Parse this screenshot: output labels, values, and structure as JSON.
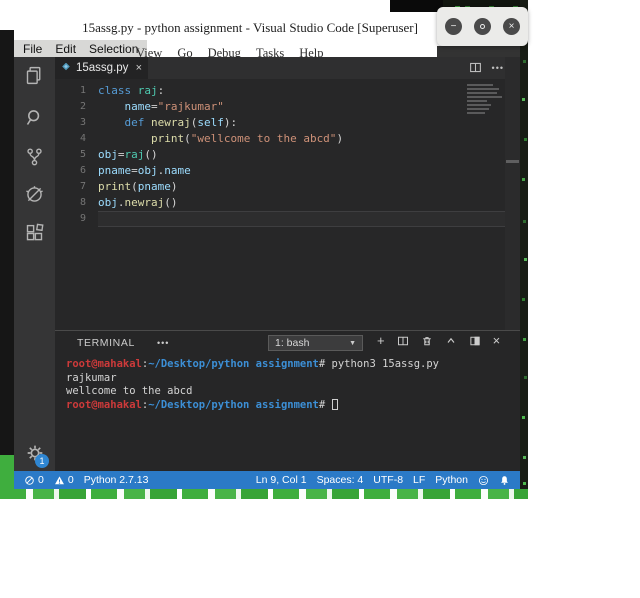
{
  "window": {
    "title": "15assg.py - python assignment - Visual Studio Code [Superuser]",
    "controls": {
      "minimize_glyph": "−",
      "close_glyph": "×"
    }
  },
  "menu_bar": {
    "left": [
      "File",
      "Edit",
      "Selection"
    ],
    "right": [
      "View",
      "Go",
      "Debug",
      "Tasks",
      "Help"
    ]
  },
  "activity_bar": {
    "icons": [
      "explorer",
      "search",
      "source-control",
      "debug",
      "extensions",
      "settings-gear"
    ],
    "settings_badge": "1"
  },
  "editor": {
    "tab": {
      "label": "15assg.py",
      "close_glyph": "×",
      "icon": "python-file-icon"
    },
    "actions": {
      "more_glyph": "•••"
    },
    "lines": [
      {
        "n": "1",
        "tokens": [
          {
            "c": "kw",
            "t": "class"
          },
          {
            "c": "pl",
            "t": " "
          },
          {
            "c": "cls",
            "t": "raj"
          },
          {
            "c": "pl",
            "t": ":"
          }
        ]
      },
      {
        "n": "2",
        "tokens": [
          {
            "c": "pl",
            "t": "    "
          },
          {
            "c": "var",
            "t": "name"
          },
          {
            "c": "pl",
            "t": "="
          },
          {
            "c": "str",
            "t": "\"rajkumar\""
          }
        ]
      },
      {
        "n": "3",
        "tokens": [
          {
            "c": "pl",
            "t": "    "
          },
          {
            "c": "kw",
            "t": "def"
          },
          {
            "c": "pl",
            "t": " "
          },
          {
            "c": "fn",
            "t": "newraj"
          },
          {
            "c": "pl",
            "t": "("
          },
          {
            "c": "var",
            "t": "self"
          },
          {
            "c": "pl",
            "t": "):"
          }
        ]
      },
      {
        "n": "4",
        "tokens": [
          {
            "c": "pl",
            "t": "        "
          },
          {
            "c": "fn",
            "t": "print"
          },
          {
            "c": "pl",
            "t": "("
          },
          {
            "c": "str",
            "t": "\"wellcome to the abcd\""
          },
          {
            "c": "pl",
            "t": ")"
          }
        ]
      },
      {
        "n": "5",
        "tokens": [
          {
            "c": "var",
            "t": "obj"
          },
          {
            "c": "pl",
            "t": "="
          },
          {
            "c": "cls",
            "t": "raj"
          },
          {
            "c": "pl",
            "t": "()"
          }
        ]
      },
      {
        "n": "6",
        "tokens": [
          {
            "c": "var",
            "t": "pname"
          },
          {
            "c": "pl",
            "t": "="
          },
          {
            "c": "var",
            "t": "obj"
          },
          {
            "c": "pl",
            "t": "."
          },
          {
            "c": "var",
            "t": "name"
          }
        ]
      },
      {
        "n": "7",
        "tokens": [
          {
            "c": "fn",
            "t": "print"
          },
          {
            "c": "pl",
            "t": "("
          },
          {
            "c": "var",
            "t": "pname"
          },
          {
            "c": "pl",
            "t": ")"
          }
        ]
      },
      {
        "n": "8",
        "tokens": [
          {
            "c": "var",
            "t": "obj"
          },
          {
            "c": "pl",
            "t": "."
          },
          {
            "c": "fn",
            "t": "newraj"
          },
          {
            "c": "pl",
            "t": "()"
          }
        ]
      },
      {
        "n": "9",
        "tokens": [],
        "active": true
      }
    ]
  },
  "terminal": {
    "label": "TERMINAL",
    "more_glyph": "•••",
    "shell_select": "1: bash",
    "caret_glyph": "▼",
    "icon_names": [
      "new-terminal",
      "split-terminal",
      "kill-terminal",
      "collapse-panel",
      "maximize-panel",
      "close-panel"
    ],
    "new_glyph": "+",
    "close_glyph": "×",
    "lines": [
      {
        "tokens": [
          {
            "c": "red",
            "t": "root@mahakal"
          },
          {
            "c": "tpl",
            "t": ":"
          },
          {
            "c": "blue",
            "t": "~/Desktop/python assignment"
          },
          {
            "c": "tpl",
            "t": "# python3 15assg.py"
          }
        ]
      },
      {
        "tokens": [
          {
            "c": "tpl",
            "t": "rajkumar"
          }
        ]
      },
      {
        "tokens": [
          {
            "c": "tpl",
            "t": "wellcome to the abcd"
          }
        ]
      },
      {
        "tokens": [
          {
            "c": "red",
            "t": "root@mahakal"
          },
          {
            "c": "tpl",
            "t": ":"
          },
          {
            "c": "blue",
            "t": "~/Desktop/python assignment"
          },
          {
            "c": "tpl",
            "t": "# "
          }
        ],
        "cursor": true
      }
    ]
  },
  "status_bar": {
    "errors": "0",
    "warnings": "0",
    "interpreter": "Python 2.7.13",
    "cursor_position": "Ln 9, Col 1",
    "indentation": "Spaces: 4",
    "encoding": "UTF-8",
    "eol": "LF",
    "language": "Python"
  },
  "colors": {
    "status_bar": "#2b7ac7",
    "editor_bg": "#272728",
    "desktop_green": "#3fae3e",
    "prompt_user": "#cd3a3a",
    "prompt_path": "#3c8fd6"
  }
}
